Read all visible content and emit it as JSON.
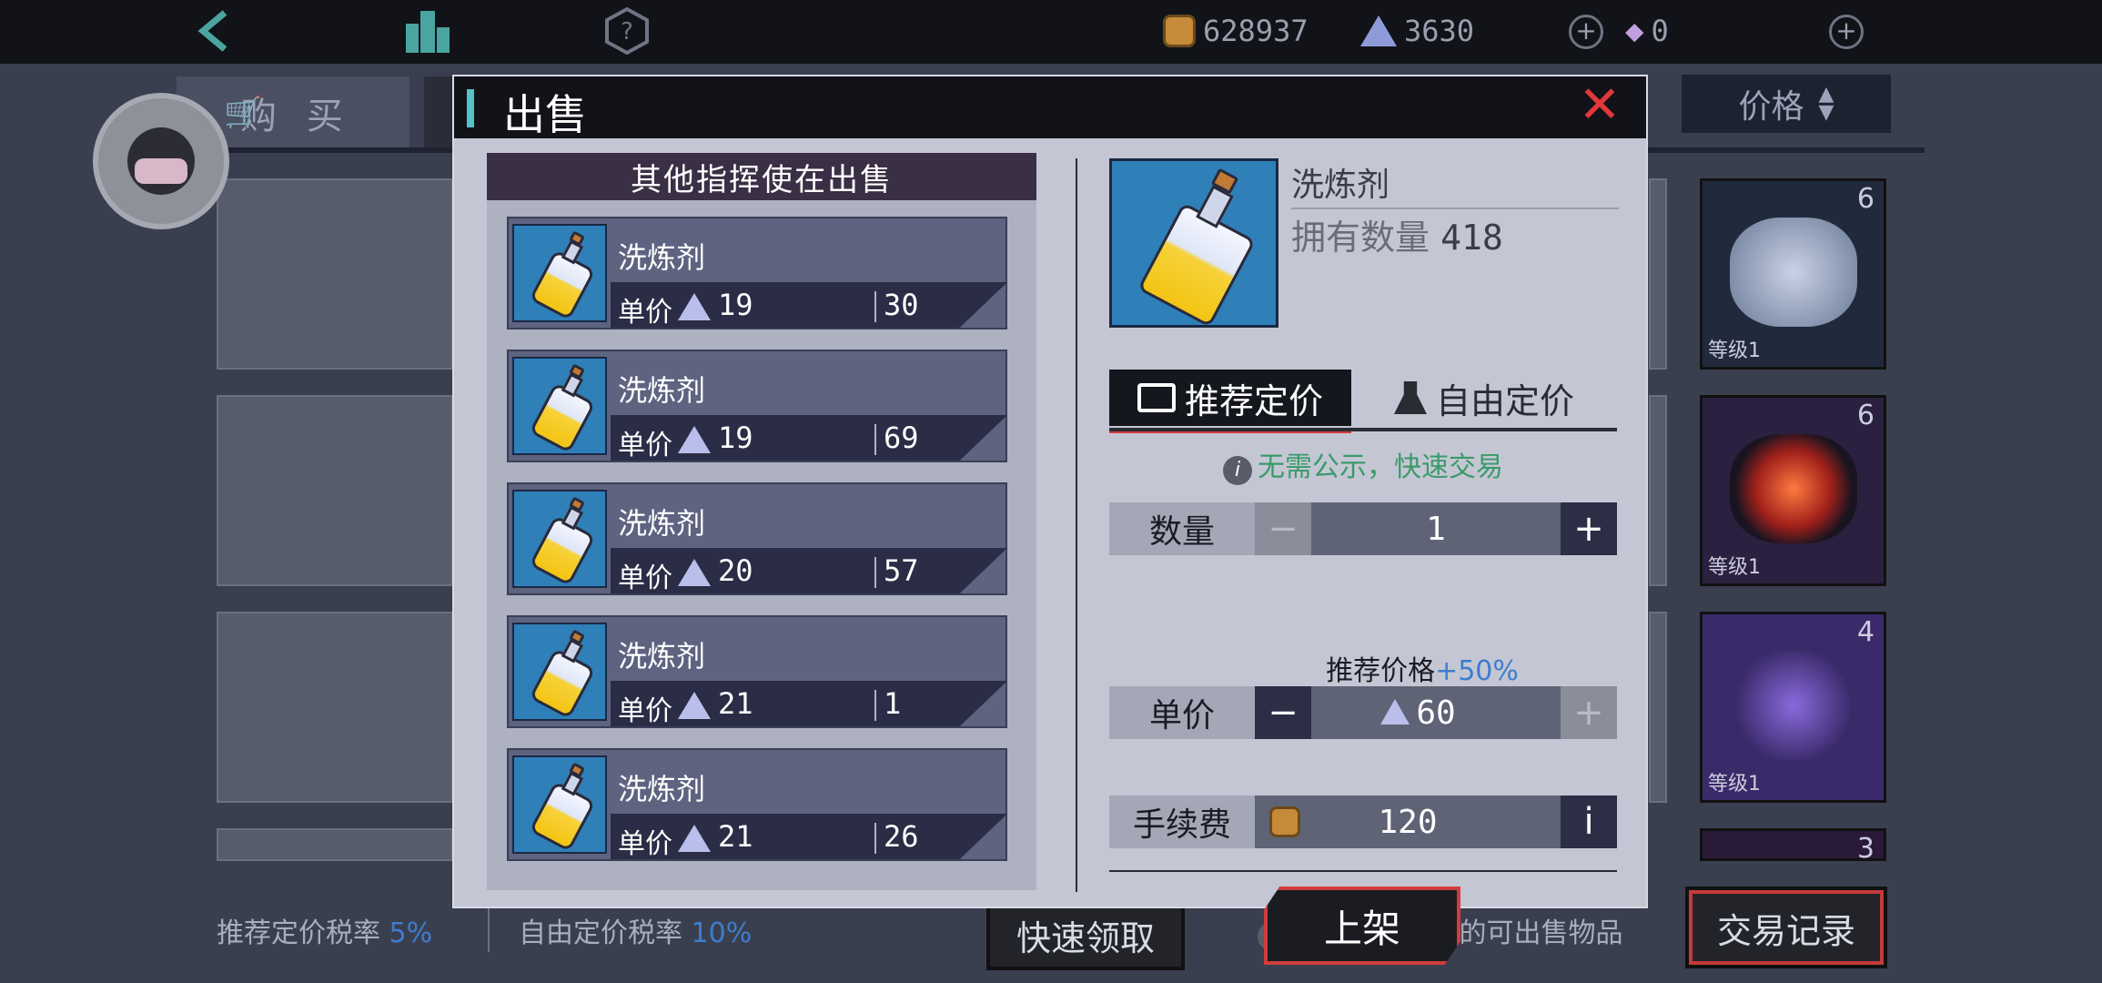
{
  "topbar": {
    "gold": "628937",
    "crystal": "3630",
    "gems": "0"
  },
  "background": {
    "buy_tab": "购 买",
    "price_filter": "价格",
    "side_cards": [
      {
        "count": "6",
        "level": "等级1"
      },
      {
        "count": "6",
        "level": "等级1"
      },
      {
        "count": "4",
        "level": "等级1"
      },
      {
        "count": "3",
        "level": ""
      }
    ],
    "tax_recommended_label": "推荐定价税率",
    "tax_recommended_value": "5%",
    "tax_free_label": "自由定价税率",
    "tax_free_value": "10%",
    "quick_collect": "快速领取",
    "notice": "仅显示非绑定的可出售物品",
    "trade_record": "交易记录"
  },
  "dialog": {
    "title": "出售",
    "others_header": "其他指挥使在出售",
    "unit_price_label": "单价",
    "listings": [
      {
        "name": "洗炼剂",
        "price": "19",
        "qty": "30"
      },
      {
        "name": "洗炼剂",
        "price": "19",
        "qty": "69"
      },
      {
        "name": "洗炼剂",
        "price": "20",
        "qty": "57"
      },
      {
        "name": "洗炼剂",
        "price": "21",
        "qty": "1"
      },
      {
        "name": "洗炼剂",
        "price": "21",
        "qty": "26"
      }
    ],
    "item": {
      "name": "洗炼剂",
      "owned_label": "拥有数量",
      "owned_count": "418"
    },
    "tabs": {
      "recommended": "推荐定价",
      "free": "自由定价"
    },
    "hint": "无需公示，快速交易",
    "quantity_label": "数量",
    "quantity_value": "1",
    "recommended_price_label": "推荐价格",
    "recommended_price_bonus": "+50%",
    "unit_price_value": "60",
    "fee_label": "手续费",
    "fee_value": "120",
    "list_button": "上架"
  },
  "colors": {
    "accent_red": "#d8393b",
    "hint_green": "#3a9a6a",
    "percent_blue": "#3d7dcc"
  }
}
